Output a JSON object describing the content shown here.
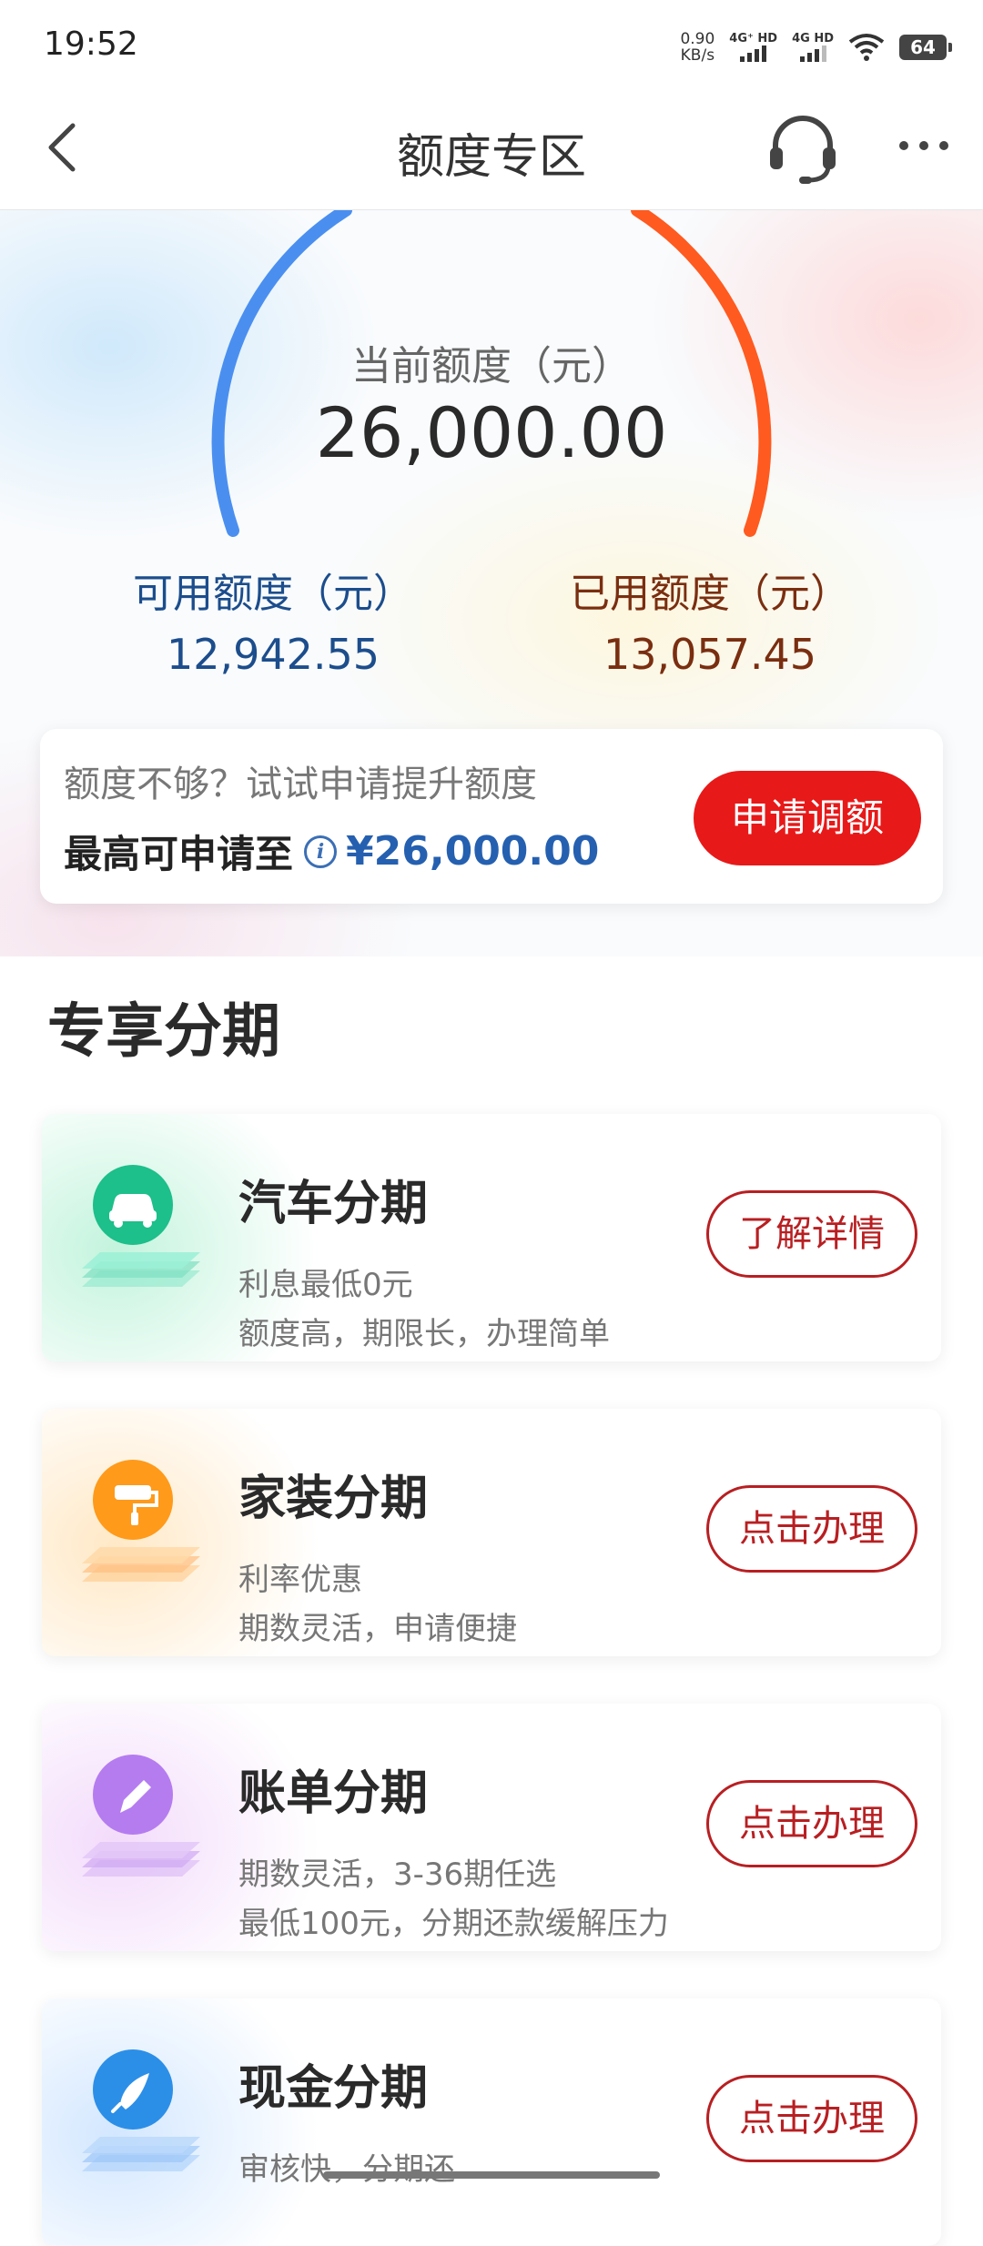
{
  "status_bar": {
    "time": "19:52",
    "net_speed_value": "0.90",
    "net_speed_unit": "KB/s",
    "sim1_label": "4G⁺ HD",
    "sim2_label": "4G HD",
    "battery": "64"
  },
  "nav": {
    "title": "额度专区"
  },
  "credit": {
    "current_label": "当前额度（元）",
    "current_amount": "26,000.00",
    "available_label": "可用额度（元）",
    "available_amount": "12,942.55",
    "used_label": "已用额度（元）",
    "used_amount": "13,057.45",
    "available_color": "#4a8ff0",
    "used_color": "#ff5a1f"
  },
  "raise": {
    "hint": "额度不够？试试申请提升额度",
    "max_label": "最高可申请至",
    "max_amount": "¥26,000.00",
    "button": "申请调额",
    "button_color": "#e81919"
  },
  "section": {
    "title": "专享分期"
  },
  "products": [
    {
      "name": "汽车分期",
      "desc1": "利息最低0元",
      "desc2": "额度高，期限长，办理简单",
      "button": "了解详情",
      "icon": "car-icon",
      "color": "#1dbf8a"
    },
    {
      "name": "家装分期",
      "desc1": "利率优惠",
      "desc2": "期数灵活，申请便捷",
      "button": "点击办理",
      "icon": "paint-roller-icon",
      "color": "#ff9a1a"
    },
    {
      "name": "账单分期",
      "desc1": "期数灵活，3-36期任选",
      "desc2": "最低100元，分期还款缓解压力",
      "button": "点击办理",
      "icon": "pencil-icon",
      "color": "#b57cf0"
    },
    {
      "name": "现金分期",
      "desc1": "审核快，分期还",
      "desc2": "",
      "button": "点击办理",
      "icon": "rocket-icon",
      "color": "#2b8fe8"
    }
  ]
}
